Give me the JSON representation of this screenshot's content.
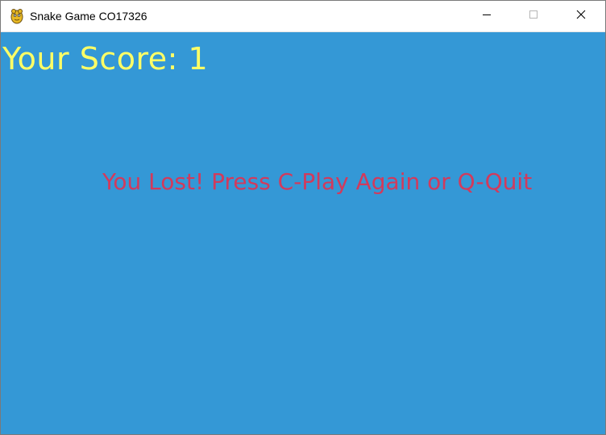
{
  "window": {
    "title": "Snake Game CO17326",
    "icon": "python-snake-icon",
    "controls": {
      "minimize_icon": "minimize-icon",
      "maximize_icon": "maximize-icon",
      "close_icon": "close-icon"
    }
  },
  "game": {
    "score_text": "Your Score: 1",
    "message": "You Lost! Press C-Play Again or Q-Quit",
    "colors": {
      "background": "#3498d6",
      "score": "#ffff66",
      "message": "#d23a5c"
    }
  }
}
